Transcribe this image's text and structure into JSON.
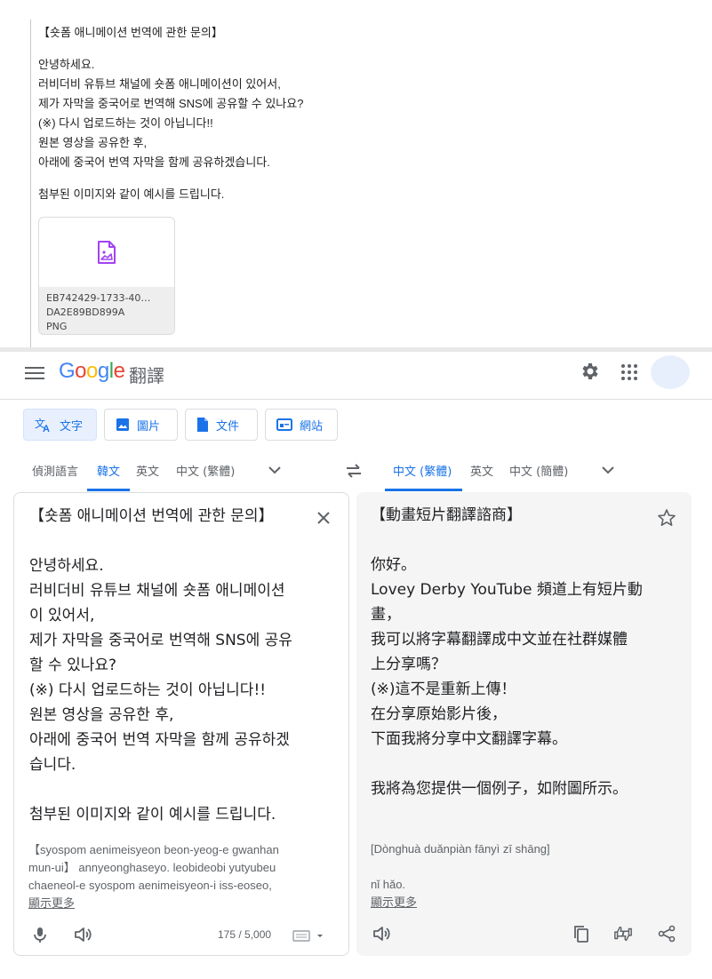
{
  "email": {
    "subject": "【숏폼 애니메이션 번역에 관한 문의】",
    "greeting": "안녕하세요.",
    "lines": [
      "러비더비 유튜브 채널에 숏폼 애니메이션이 있어서,",
      "제가 자막을 중국어로 번역해 SNS에 공유할 수 있나요?",
      "(※) 다시 업로드하는 것이 아닙니다!!",
      "원본 영상을 공유한 후,",
      "아래에 중국어 번역 자막을 함께 공유하겠습니다."
    ],
    "closing": "첨부된 이미지와 같이 예시를 드립니다.",
    "attachment": {
      "name_line1": "EB742429-1733-40…",
      "name_line2": "DA2E89BD899A",
      "type": "PNG",
      "icon": "image-file-icon"
    }
  },
  "translate": {
    "logo": "Google",
    "product": "翻譯",
    "modes": [
      "文字",
      "圖片",
      "文件",
      "網站"
    ],
    "source_langs": [
      "偵測語言",
      "韓文",
      "英文",
      "中文 (繁體)"
    ],
    "target_langs": [
      "中文 (繁體)",
      "英文",
      "中文 (簡體)"
    ],
    "source_text": [
      "【숏폼 애니메이션 번역에 관한 문의】",
      "",
      "안녕하세요.",
      "러비더비 유튜브 채널에 숏폼 애니메이션",
      "이 있어서,",
      "제가 자막을 중국어로 번역해 SNS에 공유",
      "할 수 있나요?",
      "(※) 다시 업로드하는 것이 아닙니다!!",
      "원본 영상을 공유한 후,",
      "아래에 중국어 번역 자막을 함께 공유하겠",
      "습니다.",
      "",
      "첨부된 이미지와 같이 예시를 드립니다."
    ],
    "source_romanization": [
      "【syospom aenimeisyeon beon-yeog-e gwanhan",
      "mun-ui】 annyeonghaseyo. leobideobi yutyubeu",
      "chaeneol-e syospom aenimeisyeon-i iss-eoseo,"
    ],
    "show_more": "顯示更多",
    "char_count": "175 / 5,000",
    "target_text": [
      "【動畫短片翻譯諮商】",
      "",
      "你好。",
      "Lovey Derby YouTube 頻道上有短片動",
      "畫，",
      "我可以將字幕翻譯成中文並在社群媒體",
      "上分享嗎？",
      "(※)這不是重新上傳！",
      "在分享原始影片後，",
      "下面我將分享中文翻譯字幕。",
      "",
      "我將為您提供一個例子，如附圖所示。"
    ],
    "target_romanization": [
      "[Dònghuà duǎnpiàn fānyì zī shāng]",
      "",
      "nǐ hǎo."
    ],
    "accent_color": "#1a73e8"
  }
}
